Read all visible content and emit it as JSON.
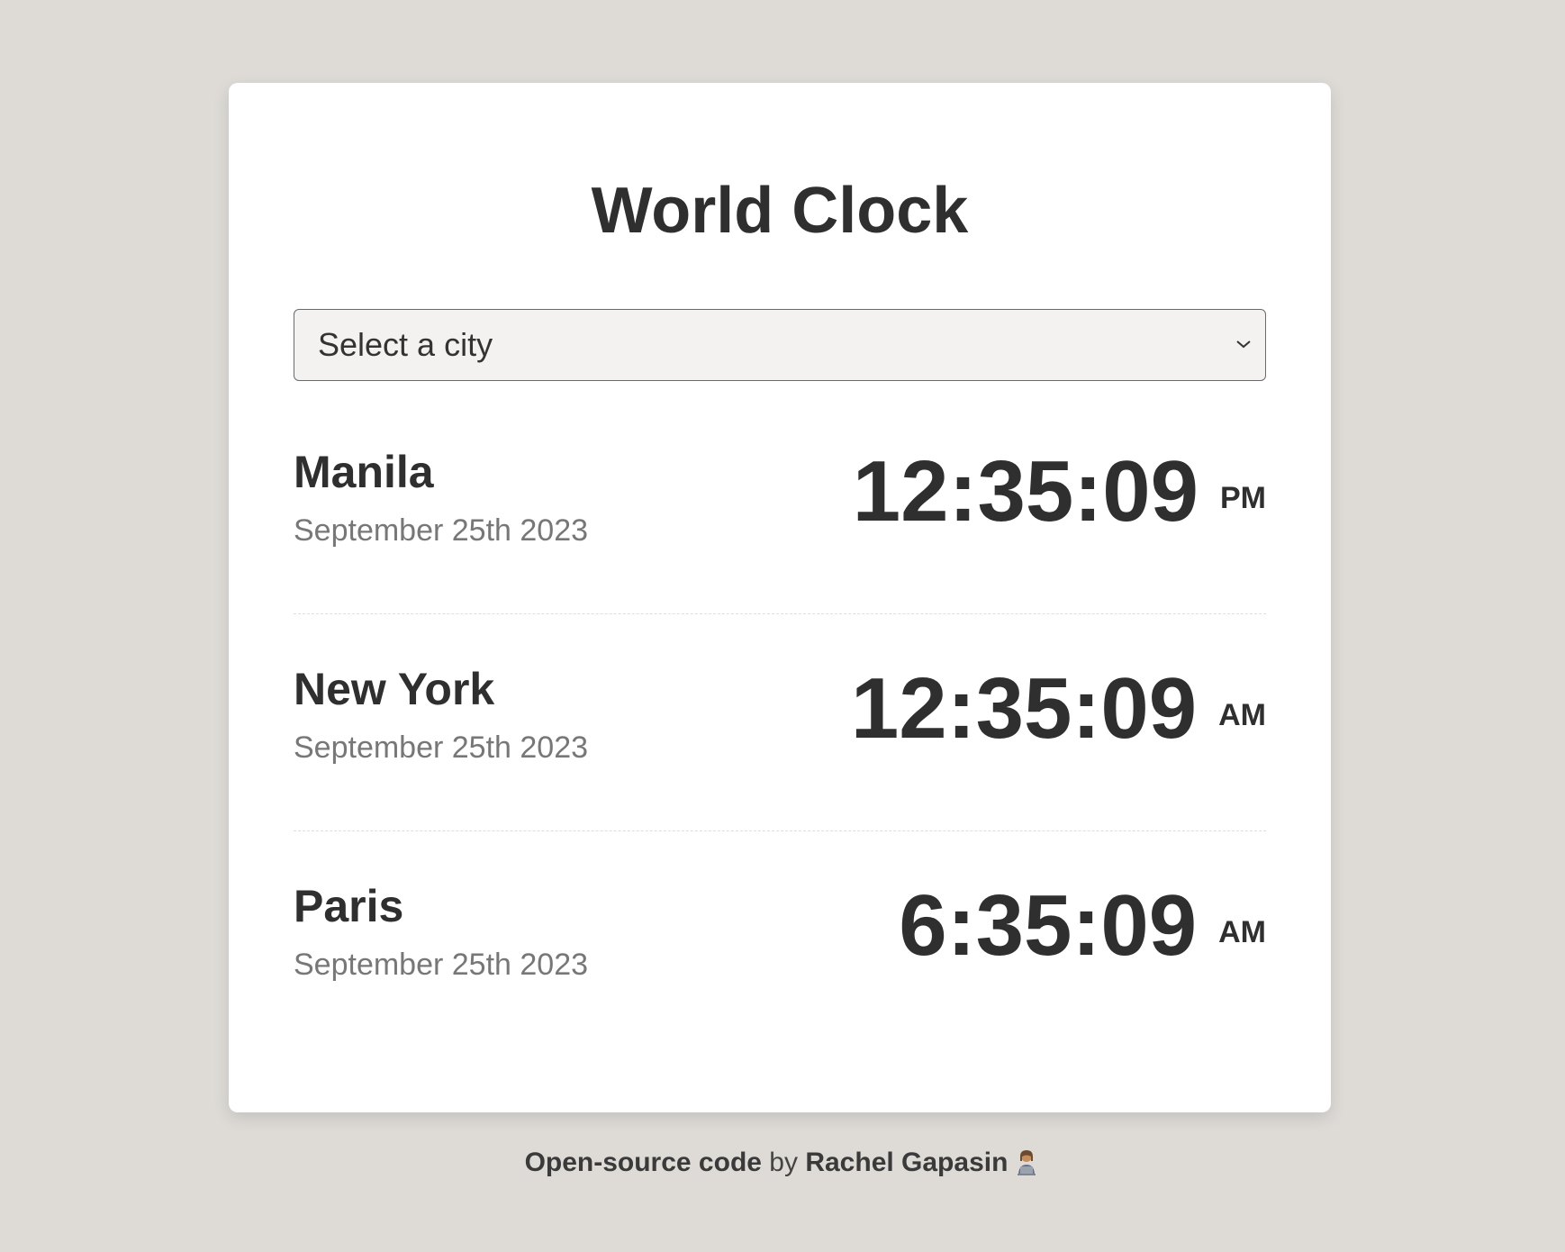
{
  "title": "World Clock",
  "select": {
    "placeholder": "Select a city"
  },
  "cities": [
    {
      "name": "Manila",
      "date": "September 25th 2023",
      "time": "12:35:09",
      "ampm": "PM"
    },
    {
      "name": "New York",
      "date": "September 25th 2023",
      "time": "12:35:09",
      "ampm": "AM"
    },
    {
      "name": "Paris",
      "date": "September 25th 2023",
      "time": "6:35:09",
      "ampm": "AM"
    }
  ],
  "footer": {
    "link_code": "Open-source code",
    "by": " by ",
    "link_author": "Rachel Gapasin",
    "emoji_icon": "technologist-emoji-icon"
  },
  "colors": {
    "background": "#dedbd7",
    "card": "#ffffff",
    "text": "#2f2f2f",
    "muted": "#777777",
    "select_bg": "#f3f2f0"
  }
}
